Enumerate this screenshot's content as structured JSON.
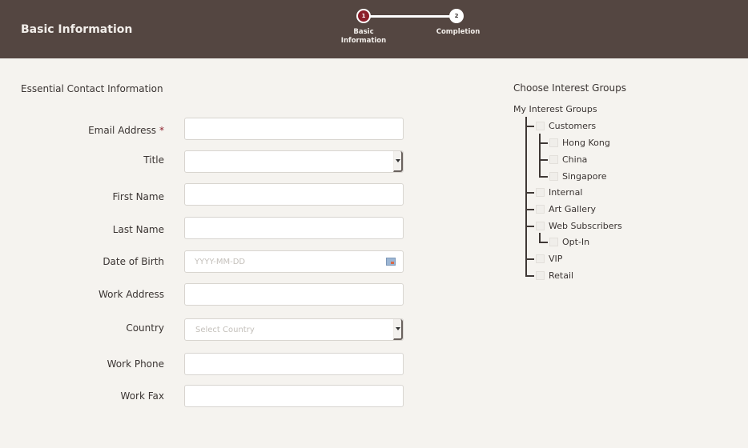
{
  "header": {
    "title": "Basic Information",
    "steps": [
      {
        "number": "1",
        "label_line1": "Basic",
        "label_line2": "Information",
        "active": true
      },
      {
        "number": "2",
        "label_line1": "Completion",
        "label_line2": "",
        "active": false
      }
    ]
  },
  "form": {
    "section_title": "Essential Contact Information",
    "required_marker": "*",
    "fields": {
      "email": {
        "label": "Email Address",
        "value": "",
        "required": true
      },
      "title": {
        "label": "Title",
        "value": ""
      },
      "first_name": {
        "label": "First Name",
        "value": ""
      },
      "last_name": {
        "label": "Last Name",
        "value": ""
      },
      "dob": {
        "label": "Date of Birth",
        "value": "",
        "placeholder": "YYYY-MM-DD"
      },
      "work_address": {
        "label": "Work Address",
        "value": ""
      },
      "country": {
        "label": "Country",
        "value": "Select Country"
      },
      "work_phone": {
        "label": "Work Phone",
        "value": ""
      },
      "work_fax": {
        "label": "Work Fax",
        "value": ""
      }
    }
  },
  "interest_groups": {
    "title": "Choose Interest Groups",
    "root": "My Interest Groups",
    "items": [
      {
        "label": "Customers",
        "checked": false
      },
      {
        "label": "Hong Kong",
        "checked": false
      },
      {
        "label": "China",
        "checked": false
      },
      {
        "label": "Singapore",
        "checked": false
      },
      {
        "label": "Internal",
        "checked": false
      },
      {
        "label": "Art Gallery",
        "checked": false
      },
      {
        "label": "Web Subscribers",
        "checked": false
      },
      {
        "label": "Opt-In",
        "checked": false
      },
      {
        "label": "VIP",
        "checked": false
      },
      {
        "label": "Retail",
        "checked": false
      }
    ]
  },
  "colors": {
    "header_bg": "#544641",
    "accent": "#8c1e2a",
    "page_bg": "#f5f3ef"
  }
}
